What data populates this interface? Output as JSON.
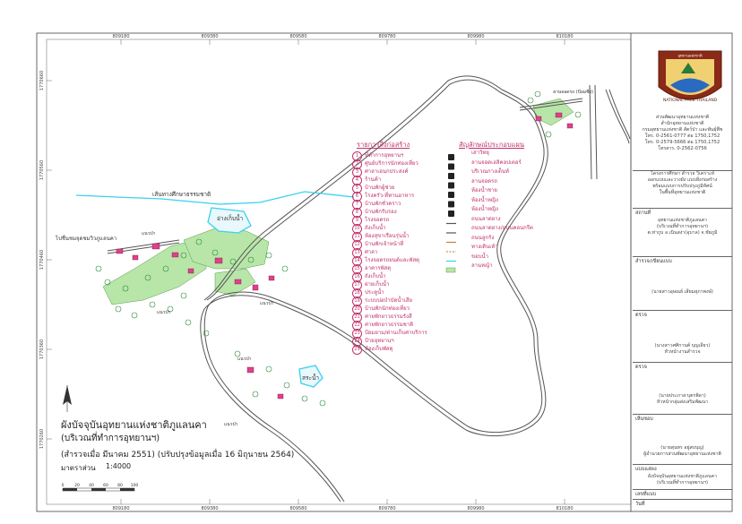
{
  "map": {
    "title": "ผังบัจจุบันอุทยานแห่งชาติภูแลนคา",
    "subtitle": "(บริเวณที่ทำการอุทยานฯ)",
    "survey_note": "(สำรวจเมื่อ มีนาคม 2551) (ปรับปรุงข้อมูลเมื่อ 16 มิถุนายน 2564)",
    "scale_label": "มาตราส่วน",
    "scale_value": "1:4000",
    "scale_bar_ticks": [
      "0",
      "20",
      "40",
      "60",
      "80",
      "100"
    ],
    "x_ticks": [
      "809180",
      "809380",
      "809580",
      "809780",
      "809980",
      "810180"
    ],
    "y_ticks": [
      "1770660",
      "1770560",
      "1770460",
      "1770360",
      "1770260"
    ],
    "place_labels": {
      "nature_trail": "เส้นทางศึกษาธรรมชาติ",
      "reservoir": "อ่างเก็บน้ำ",
      "pond": "สระน้ำ",
      "viewpoint": "ไปชื่นชมจุดชมวิวภูแลนคา",
      "checkpoint": "ลานจอดรถ (ป้อมซิ่ง)",
      "forest": [
        "แนวป่า",
        "แนวป่า",
        "แนวป่า",
        "แนวป่า",
        "แนวป่า"
      ]
    },
    "building_legend_title": "รายการสิ่งก่อสร้าง",
    "buildings": [
      "ที่ทำการอุทยานฯ",
      "ศูนย์บริการนักท่องเที่ยว",
      "ศาลาเอนกประสงค์",
      "ร้านค้า",
      "บ้านพักผู้ช่วย",
      "โรงครัว-ที่ทานอาหาร",
      "บ้านพักชั่วคราว",
      "บ้านพักรับรอง",
      "โรงจอดรถ",
      "ถังเก็บน้ำ",
      "ห้องสุขาเรือนรุ่นน้ำ",
      "บ้านพักเจ้าหน้าที่",
      "ศาลา",
      "โรงจอดรถยนต์และพัสดุ",
      "อาคารพัสดุ",
      "ถังเก็บน้ำ",
      "ฝายเก็บน้ำ",
      "ประตูน้ำ",
      "ระบบบ่อบำบัดน้ำเสีย",
      "บ้านพักนักท่องเที่ยว",
      "ค่ายพักยาวธรรมรังสี",
      "ค่ายพักยาวธรรมชาติ",
      "ป้อมยาม/ด่านเก็บค่าบริการ",
      "ป้ายอุทยานฯ",
      "ห้องเก็บพัสดุ"
    ],
    "symbol_legend_title": "สัญลักษณ์ประกอบแผน",
    "symbols": [
      {
        "label": "เสาวิทยุ",
        "icon": "radio-mast-icon"
      },
      {
        "label": "ลานจอดเฮลิคอปเตอร์",
        "icon": "helipad-icon"
      },
      {
        "label": "บริเวณกางเต็นท์",
        "icon": "tent-icon"
      },
      {
        "label": "ลานจอดรถ",
        "icon": "parking-icon"
      },
      {
        "label": "ห้องน้ำชาย",
        "icon": "toilet-male-icon"
      },
      {
        "label": "ห้องน้ำหญิง",
        "icon": "toilet-female-icon"
      },
      {
        "label": "ห้องน้ำหญิง",
        "icon": "toilet-female-icon"
      },
      {
        "label": "ถนนลาดยาง",
        "icon": "paved-road-line"
      },
      {
        "label": "ถนนลาดยาง/ถนนคอนกรีต",
        "icon": "road-line"
      },
      {
        "label": "ถนนลูกรัง",
        "icon": "laterite-road-line"
      },
      {
        "label": "ทางเดินเท้า",
        "icon": "footpath-line"
      },
      {
        "label": "ขอบน้ำ",
        "icon": "water-edge-line"
      },
      {
        "label": "ลานหญ้า",
        "icon": "lawn-swatch"
      }
    ],
    "colors": {
      "road": "#666666",
      "water": "#3ad0f0",
      "lawn": "#b8e6a8",
      "building": "#e0408a",
      "legend_text": "#c0306a"
    }
  },
  "title_block": {
    "org": [
      "ส่วนพัฒนาอุทยานแห่งชาติ",
      "สำนักอุทยานแห่งชาติ",
      "กรมอุทยานแห่งชาติ สัตว์ป่า และพันธุ์พืช"
    ],
    "contacts": [
      "โทร. 0-2561-0777 ต่อ 1750,1752",
      "โทร. 0-2579-5666 ต่อ 1750,1752",
      "โทรสาร. 0-2562-0756"
    ],
    "project": [
      "โครงการศึกษา สำรวจ วิเคราะห์",
      "ออกแบบและวางผัง แบบสิ่งก่อสร้าง",
      "พร้อมแบบการปรับปรุงภูมิทัศน์",
      "ในพื้นที่อุทยานแห่งชาติ"
    ],
    "location_head": "สถานที่",
    "location": [
      "อุทยานแห่งชาติภูแลนคา",
      "(บริเวณที่ทำการอุทยานฯ)",
      "ต.ท่ากูบ อ.เนินสง่า(อุบาล) จ.ชัยภูมิ"
    ],
    "surveyor_head": "สำรวจ/เขียนแบบ",
    "surveyor": "(นายสาวอุษณย์ เสียมสุภาพงษ์)",
    "checker_head": "ตรวจ",
    "checker": [
      "(นางสาวศศิกานต์ บุญเลียว)",
      "หัวหน้างานสำรวจ"
    ],
    "inspector_head": "ตรวจ",
    "inspector": [
      "(นายประภาส บุตรพิลา)",
      "หัวหน้ากลุ่มส่งเสริมพัฒนา"
    ],
    "approver_head": "เห็นชอบ",
    "approver": [
      "(นายสุนทร อยู่สบบุญ)",
      "ผู้อำนวยการส่วนพัฒนาอุทยานแห่งชาติ"
    ],
    "sheet_title_head": "แบบแสดง",
    "sheet_title": [
      "ผังบัจจุบันอุทยานแห่งชาติภูแลนคา",
      "(บริเวณที่ทำการอุทยานฯ)"
    ],
    "sheet_no_head": "เลขที่แบบ",
    "date_head": "วันที่",
    "logo_text": "NATIONAL PARK THAILAND",
    "logo_top": "อุทยานแห่งชาติ"
  }
}
